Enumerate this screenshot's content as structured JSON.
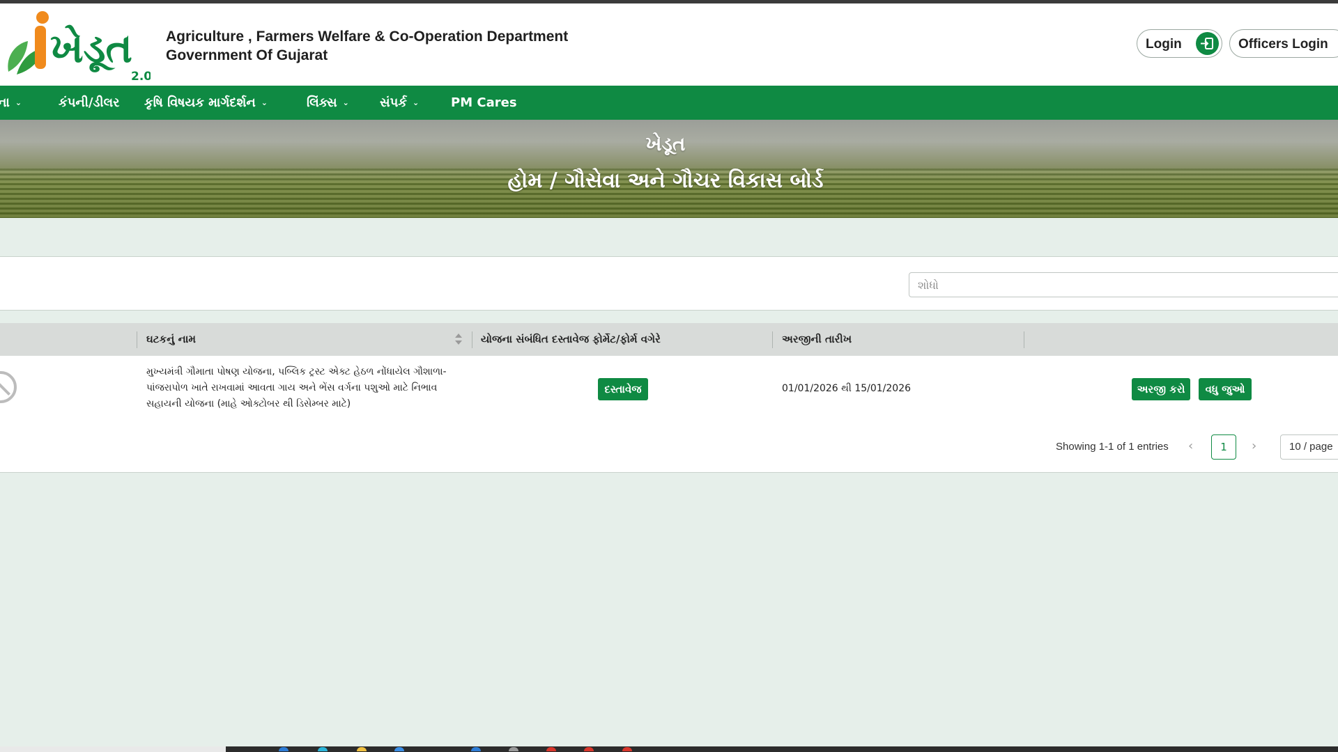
{
  "header": {
    "logo_text": "ખેડૂત",
    "logo_version": "2.0",
    "dept_line1": "Agriculture , Farmers Welfare & Co-Operation Department",
    "dept_line2": "Government Of Gujarat",
    "login_label": "Login",
    "officers_login_label": "Officers Login"
  },
  "nav": {
    "items": [
      {
        "label": "ના",
        "has_dropdown": true
      },
      {
        "label": "કંપની/ડીલર",
        "has_dropdown": false
      },
      {
        "label": "કૃષિ વિષયક માર્ગદર્શન",
        "has_dropdown": true
      },
      {
        "label": "લિંક્સ",
        "has_dropdown": true
      },
      {
        "label": "સંપર્ક",
        "has_dropdown": true
      },
      {
        "label": "PM Cares",
        "has_dropdown": false
      }
    ]
  },
  "banner": {
    "title": "ખેડૂત",
    "breadcrumb": "હોમ / ગૌસેવા અને ગૌચર વિકાસ બોર્ડ"
  },
  "search": {
    "placeholder": "શોધો",
    "value": ""
  },
  "table": {
    "columns": [
      "ઘટકનું નામ",
      "યોજના સંબંધિત દસ્તાવેજ ફોર્મેટ/ફોર્મ વગેરે",
      "અરજીની તારીખ",
      ""
    ],
    "rows": [
      {
        "name": "મુખ્યમંત્રી ગૌમાતા પોષણ યોજના, પબ્લિક ટ્રસ્ટ એક્ટ હેઠળ નોંધાયેલ ગૌશાળા-પાંજરાપોળ ખાતે રાખવામાં આવતા ગાય અને ભેંસ વર્ગના પશુઓ માટે નિભાવ સહાયની યોજના (માહે ઓક્ટોબર થી ડિસેમ્બર માટે)",
        "document_label": "દસ્તાવેજ",
        "date": "01/01/2026 થી 15/01/2026",
        "apply_label": "અરજી કરો",
        "more_label": "વધુ જુઓ"
      }
    ]
  },
  "pagination": {
    "info": "Showing 1-1 of 1 entries",
    "current_page": "1",
    "page_size": "10 / page"
  },
  "colors": {
    "primary_green": "#0f8a43",
    "page_bg": "#e6efea",
    "logo_orange": "#f08a1c"
  }
}
